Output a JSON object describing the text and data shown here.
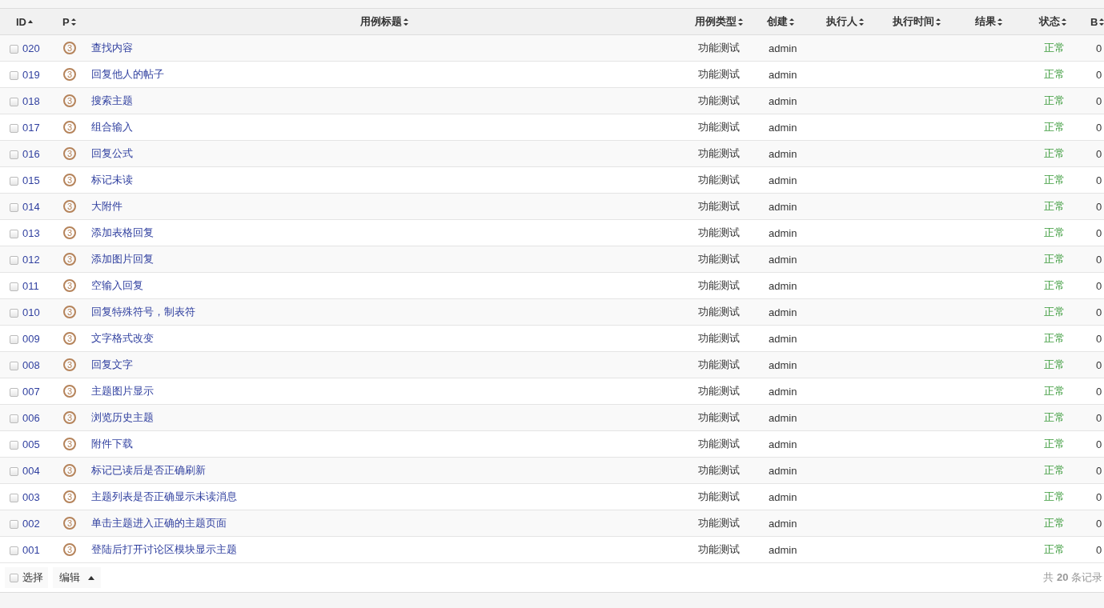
{
  "table": {
    "columns": [
      {
        "label": "ID",
        "sorted": true
      },
      {
        "label": "P",
        "sorted": false
      },
      {
        "label": "用例标题",
        "sorted": false
      },
      {
        "label": "用例类型",
        "sorted": false
      },
      {
        "label": "创建",
        "sorted": false
      },
      {
        "label": "执行人",
        "sorted": false
      },
      {
        "label": "执行时间",
        "sorted": false
      },
      {
        "label": "结果",
        "sorted": false
      },
      {
        "label": "状态",
        "sorted": false
      },
      {
        "label": "B",
        "sorted": false
      }
    ],
    "rows": [
      {
        "checked": false,
        "id": "020",
        "priority": "3",
        "title": "查找内容",
        "type": "功能测试",
        "creator": "admin",
        "status": "正常",
        "column_b": "0"
      },
      {
        "checked": false,
        "id": "019",
        "priority": "3",
        "title": "回复他人的帖子",
        "type": "功能测试",
        "creator": "admin",
        "status": "正常",
        "column_b": "0"
      },
      {
        "checked": false,
        "id": "018",
        "priority": "3",
        "title": "搜索主题",
        "type": "功能测试",
        "creator": "admin",
        "status": "正常",
        "column_b": "0"
      },
      {
        "checked": false,
        "id": "017",
        "priority": "3",
        "title": "组合输入",
        "type": "功能测试",
        "creator": "admin",
        "status": "正常",
        "column_b": "0"
      },
      {
        "checked": false,
        "id": "016",
        "priority": "3",
        "title": "回复公式",
        "type": "功能测试",
        "creator": "admin",
        "status": "正常",
        "column_b": "0"
      },
      {
        "checked": false,
        "id": "015",
        "priority": "3",
        "title": "标记未读",
        "type": "功能测试",
        "creator": "admin",
        "status": "正常",
        "column_b": "0"
      },
      {
        "checked": false,
        "id": "014",
        "priority": "3",
        "title": "大附件",
        "type": "功能测试",
        "creator": "admin",
        "status": "正常",
        "column_b": "0"
      },
      {
        "checked": false,
        "id": "013",
        "priority": "3",
        "title": "添加表格回复",
        "type": "功能测试",
        "creator": "admin",
        "status": "正常",
        "column_b": "0"
      },
      {
        "checked": false,
        "id": "012",
        "priority": "3",
        "title": "添加图片回复",
        "type": "功能测试",
        "creator": "admin",
        "status": "正常",
        "column_b": "0"
      },
      {
        "checked": false,
        "id": "011",
        "priority": "3",
        "title": "空输入回复",
        "type": "功能测试",
        "creator": "admin",
        "status": "正常",
        "column_b": "0"
      },
      {
        "checked": false,
        "id": "010",
        "priority": "3",
        "title": "回复特殊符号，制表符",
        "type": "功能测试",
        "creator": "admin",
        "status": "正常",
        "column_b": "0"
      },
      {
        "checked": false,
        "id": "009",
        "priority": "3",
        "title": "文字格式改变",
        "type": "功能测试",
        "creator": "admin",
        "status": "正常",
        "column_b": "0"
      },
      {
        "checked": false,
        "id": "008",
        "priority": "3",
        "title": "回复文字",
        "type": "功能测试",
        "creator": "admin",
        "status": "正常",
        "column_b": "0"
      },
      {
        "checked": false,
        "id": "007",
        "priority": "3",
        "title": "主题图片显示",
        "type": "功能测试",
        "creator": "admin",
        "status": "正常",
        "column_b": "0"
      },
      {
        "checked": false,
        "id": "006",
        "priority": "3",
        "title": "浏览历史主题",
        "type": "功能测试",
        "creator": "admin",
        "status": "正常",
        "column_b": "0"
      },
      {
        "checked": false,
        "id": "005",
        "priority": "3",
        "title": "附件下载",
        "type": "功能测试",
        "creator": "admin",
        "status": "正常",
        "column_b": "0"
      },
      {
        "checked": false,
        "id": "004",
        "priority": "3",
        "title": "标记已读后是否正确刷新",
        "type": "功能测试",
        "creator": "admin",
        "status": "正常",
        "column_b": "0"
      },
      {
        "checked": false,
        "id": "003",
        "priority": "3",
        "title": "主题列表是否正确显示未读消息",
        "type": "功能测试",
        "creator": "admin",
        "status": "正常",
        "column_b": "0"
      },
      {
        "checked": false,
        "id": "002",
        "priority": "3",
        "title": "单击主题进入正确的主题页面",
        "type": "功能测试",
        "creator": "admin",
        "status": "正常",
        "column_b": "0"
      },
      {
        "checked": false,
        "id": "001",
        "priority": "3",
        "title": "登陆后打开讨论区模块显示主题",
        "type": "功能测试",
        "creator": "admin",
        "status": "正常",
        "column_b": "0"
      }
    ]
  },
  "footer": {
    "select_all": {
      "label": "选择",
      "checked": false
    },
    "edit_button": "编辑",
    "summary": "共 **20** 条记录"
  }
}
